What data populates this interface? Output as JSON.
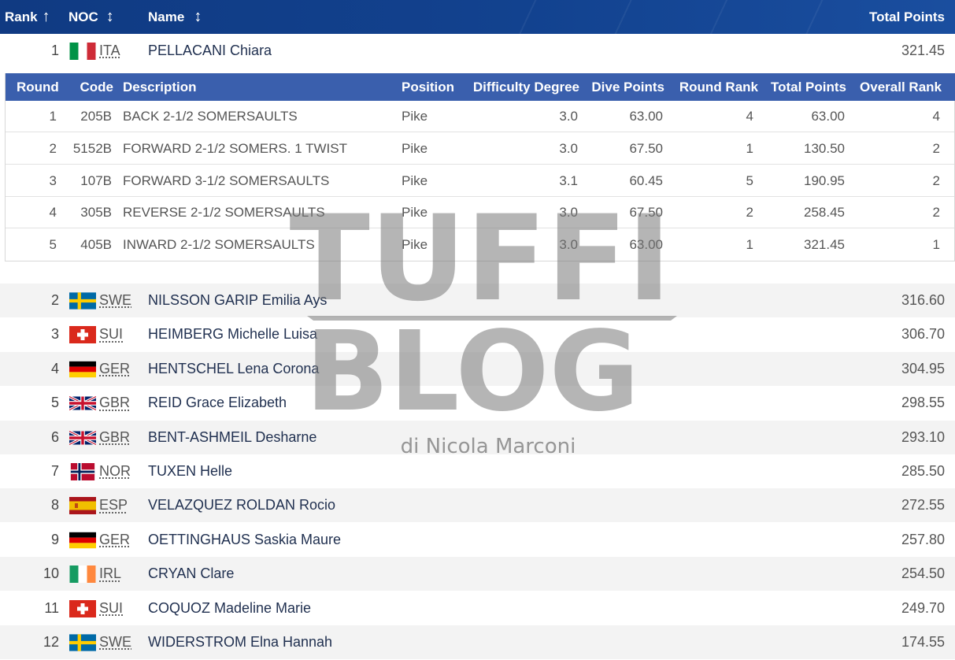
{
  "header": {
    "rank_label": "Rank",
    "noc_label": "NOC",
    "name_label": "Name",
    "total_label": "Total Points"
  },
  "expanded": {
    "rank": "1",
    "noc": "ITA",
    "flag": "italy-flag",
    "name": "PELLACANI Chiara",
    "points": "321.45"
  },
  "detail": {
    "columns": [
      "Round",
      "Code",
      "Description",
      "Position",
      "Difficulty Degree",
      "Dive Points",
      "Round Rank",
      "Total Points",
      "Overall Rank"
    ],
    "rows": [
      [
        "1",
        "205B",
        "BACK 2-1/2 SOMERSAULTS",
        "Pike",
        "3.0",
        "63.00",
        "4",
        "63.00",
        "4"
      ],
      [
        "2",
        "5152B",
        "FORWARD 2-1/2 SOMERS. 1 TWIST",
        "Pike",
        "3.0",
        "67.50",
        "1",
        "130.50",
        "2"
      ],
      [
        "3",
        "107B",
        "FORWARD 3-1/2 SOMERSAULTS",
        "Pike",
        "3.1",
        "60.45",
        "5",
        "190.95",
        "2"
      ],
      [
        "4",
        "305B",
        "REVERSE 2-1/2 SOMERSAULTS",
        "Pike",
        "3.0",
        "67.50",
        "2",
        "258.45",
        "2"
      ],
      [
        "5",
        "405B",
        "INWARD 2-1/2 SOMERSAULTS",
        "Pike",
        "3.0",
        "63.00",
        "1",
        "321.45",
        "1"
      ]
    ]
  },
  "rows": [
    {
      "rank": "2",
      "noc": "SWE",
      "flag": "sweden-flag",
      "name": "NILSSON GARIP Emilia Ays",
      "points": "316.60"
    },
    {
      "rank": "3",
      "noc": "SUI",
      "flag": "switzerland-flag",
      "name": "HEIMBERG Michelle Luisa",
      "points": "306.70"
    },
    {
      "rank": "4",
      "noc": "GER",
      "flag": "germany-flag",
      "name": "HENTSCHEL Lena Corona",
      "points": "304.95"
    },
    {
      "rank": "5",
      "noc": "GBR",
      "flag": "uk-flag",
      "name": "REID Grace Elizabeth",
      "points": "298.55"
    },
    {
      "rank": "6",
      "noc": "GBR",
      "flag": "uk-flag",
      "name": "BENT-ASHMEIL Desharne",
      "points": "293.10"
    },
    {
      "rank": "7",
      "noc": "NOR",
      "flag": "norway-flag",
      "name": "TUXEN Helle",
      "points": "285.50"
    },
    {
      "rank": "8",
      "noc": "ESP",
      "flag": "spain-flag",
      "name": "VELAZQUEZ ROLDAN Rocio",
      "points": "272.55"
    },
    {
      "rank": "9",
      "noc": "GER",
      "flag": "germany-flag",
      "name": "OETTINGHAUS Saskia Maure",
      "points": "257.80"
    },
    {
      "rank": "10",
      "noc": "IRL",
      "flag": "ireland-flag",
      "name": "CRYAN Clare",
      "points": "254.50"
    },
    {
      "rank": "11",
      "noc": "SUI",
      "flag": "switzerland-flag",
      "name": "COQUOZ Madeline Marie",
      "points": "249.70"
    },
    {
      "rank": "12",
      "noc": "SWE",
      "flag": "sweden-flag",
      "name": "WIDERSTROM Elna Hannah",
      "points": "174.55"
    }
  ],
  "watermark": {
    "line1": "TUFFI",
    "line2": "BLOG",
    "line3": "di Nicola Marconi"
  }
}
